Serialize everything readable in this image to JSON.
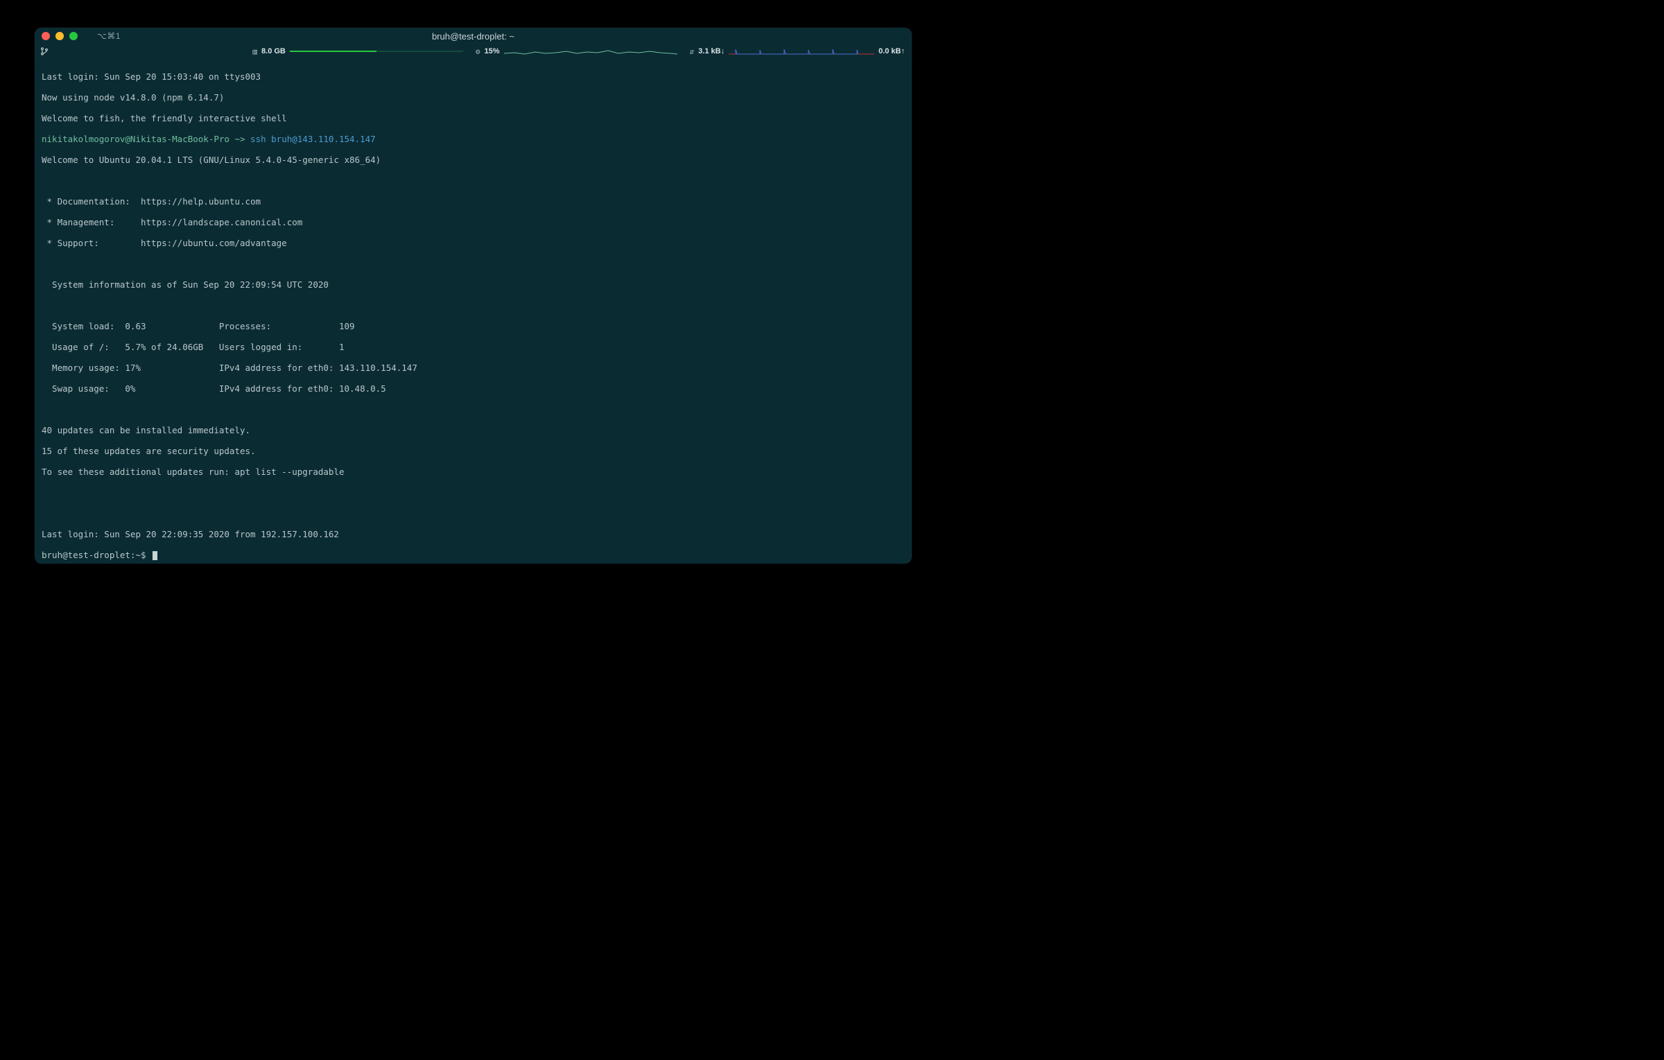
{
  "window": {
    "title": "bruh@test-droplet: ~",
    "shortcut": "⌥⌘1"
  },
  "status": {
    "memory_label": "8.0 GB",
    "cpu_label": "15%",
    "net_down": "3.1 kB↓",
    "net_up": "0.0 kB↑"
  },
  "terminal": {
    "l1": "Last login: Sun Sep 20 15:03:40 on ttys003",
    "l2": "Now using node v14.8.0 (npm 6.14.7)",
    "l3": "Welcome to fish, the friendly interactive shell",
    "prompt1_user": "nikitakolmogorov@Nikitas-MacBook-Pro",
    "prompt1_sep": " ~> ",
    "prompt1_cmd": "ssh",
    "prompt1_target": " bruh@143.110.154.147",
    "l5": "Welcome to Ubuntu 20.04.1 LTS (GNU/Linux 5.4.0-45-generic x86_64)",
    "l7": " * Documentation:  https://help.ubuntu.com",
    "l8": " * Management:     https://landscape.canonical.com",
    "l9": " * Support:        https://ubuntu.com/advantage",
    "l11": "  System information as of Sun Sep 20 22:09:54 UTC 2020",
    "l13": "  System load:  0.63              Processes:             109",
    "l14": "  Usage of /:   5.7% of 24.06GB   Users logged in:       1",
    "l15": "  Memory usage: 17%               IPv4 address for eth0: 143.110.154.147",
    "l16": "  Swap usage:   0%                IPv4 address for eth0: 10.48.0.5",
    "l18": "40 updates can be installed immediately.",
    "l19": "15 of these updates are security updates.",
    "l20": "To see these additional updates run: apt list --upgradable",
    "l23": "Last login: Sun Sep 20 22:09:35 2020 from 192.157.100.162",
    "prompt2": "bruh@test-droplet:~$ "
  }
}
